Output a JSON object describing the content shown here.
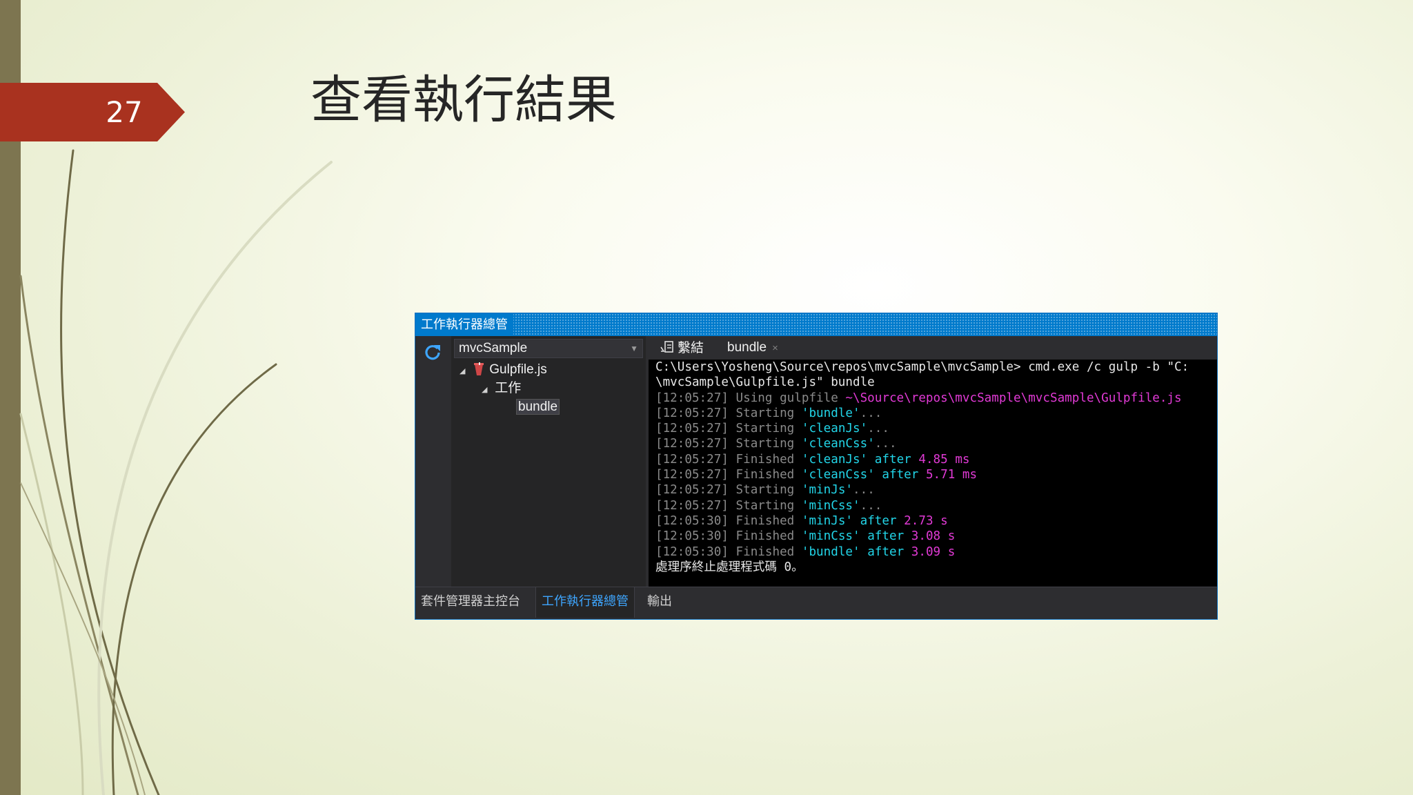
{
  "slide": {
    "number": "27",
    "title": "查看執行結果",
    "colors": {
      "accent_badge": "#a9321f",
      "left_bar": "#7d7550"
    }
  },
  "task_runner": {
    "window_title": "工作執行器總管",
    "refresh_icon": "refresh-icon",
    "project_dropdown": {
      "selected": "mvcSample"
    },
    "tree": {
      "gulpfile": "Gulpfile.js",
      "tasks_folder": "工作",
      "task_bundle": "bundle"
    },
    "tabs": {
      "bindings": "繫結",
      "bundle": "bundle",
      "close": "×"
    },
    "console_lines": [
      [
        {
          "t": "C:\\Users\\Yosheng\\Source\\repos\\mvcSample\\mvcSample> cmd.exe /c gulp -b \"C:",
          "c": "w"
        }
      ],
      [
        {
          "t": "\\mvcSample\\Gulpfile.js\" bundle",
          "c": "w"
        }
      ],
      [
        {
          "t": "[12:05:27] Using gulpfile ",
          "c": "g"
        },
        {
          "t": "~\\Source\\repos\\mvcSample\\mvcSample\\Gulpfile.js",
          "c": "m"
        }
      ],
      [
        {
          "t": "[12:05:27] Starting ",
          "c": "g"
        },
        {
          "t": "'bundle'",
          "c": "c"
        },
        {
          "t": "...",
          "c": "g"
        }
      ],
      [
        {
          "t": "[12:05:27] Starting ",
          "c": "g"
        },
        {
          "t": "'cleanJs'",
          "c": "c"
        },
        {
          "t": "...",
          "c": "g"
        }
      ],
      [
        {
          "t": "[12:05:27] Starting ",
          "c": "g"
        },
        {
          "t": "'cleanCss'",
          "c": "c"
        },
        {
          "t": "...",
          "c": "g"
        }
      ],
      [
        {
          "t": "[12:05:27] Finished ",
          "c": "g"
        },
        {
          "t": "'cleanJs'",
          "c": "c"
        },
        {
          "t": " after ",
          "c": "c"
        },
        {
          "t": "4.85 ms",
          "c": "m"
        }
      ],
      [
        {
          "t": "[12:05:27] Finished ",
          "c": "g"
        },
        {
          "t": "'cleanCss'",
          "c": "c"
        },
        {
          "t": " after ",
          "c": "c"
        },
        {
          "t": "5.71 ms",
          "c": "m"
        }
      ],
      [
        {
          "t": "[12:05:27] Starting ",
          "c": "g"
        },
        {
          "t": "'minJs'",
          "c": "c"
        },
        {
          "t": "...",
          "c": "g"
        }
      ],
      [
        {
          "t": "[12:05:27] Starting ",
          "c": "g"
        },
        {
          "t": "'minCss'",
          "c": "c"
        },
        {
          "t": "...",
          "c": "g"
        }
      ],
      [
        {
          "t": "[12:05:30] Finished ",
          "c": "g"
        },
        {
          "t": "'minJs'",
          "c": "c"
        },
        {
          "t": " after ",
          "c": "c"
        },
        {
          "t": "2.73 s",
          "c": "m"
        }
      ],
      [
        {
          "t": "[12:05:30] Finished ",
          "c": "g"
        },
        {
          "t": "'minCss'",
          "c": "c"
        },
        {
          "t": " after ",
          "c": "c"
        },
        {
          "t": "3.08 s",
          "c": "m"
        }
      ],
      [
        {
          "t": "[12:05:30] Finished ",
          "c": "g"
        },
        {
          "t": "'bundle'",
          "c": "c"
        },
        {
          "t": " after ",
          "c": "c"
        },
        {
          "t": "3.09 s",
          "c": "m"
        }
      ],
      [
        {
          "t": "處理序終止處理程式碼 0。",
          "c": "w2"
        }
      ]
    ],
    "bottom_tabs": [
      {
        "label": "套件管理器主控台",
        "active": false
      },
      {
        "label": "工作執行器總管",
        "active": true
      },
      {
        "label": "輸出",
        "active": false
      }
    ],
    "colors": {
      "titlebar": "#007acc",
      "console_bg": "#000000",
      "cyan": "#22d5e8",
      "magenta": "#e23ad6",
      "active_tab": "#3ea6ff"
    }
  }
}
